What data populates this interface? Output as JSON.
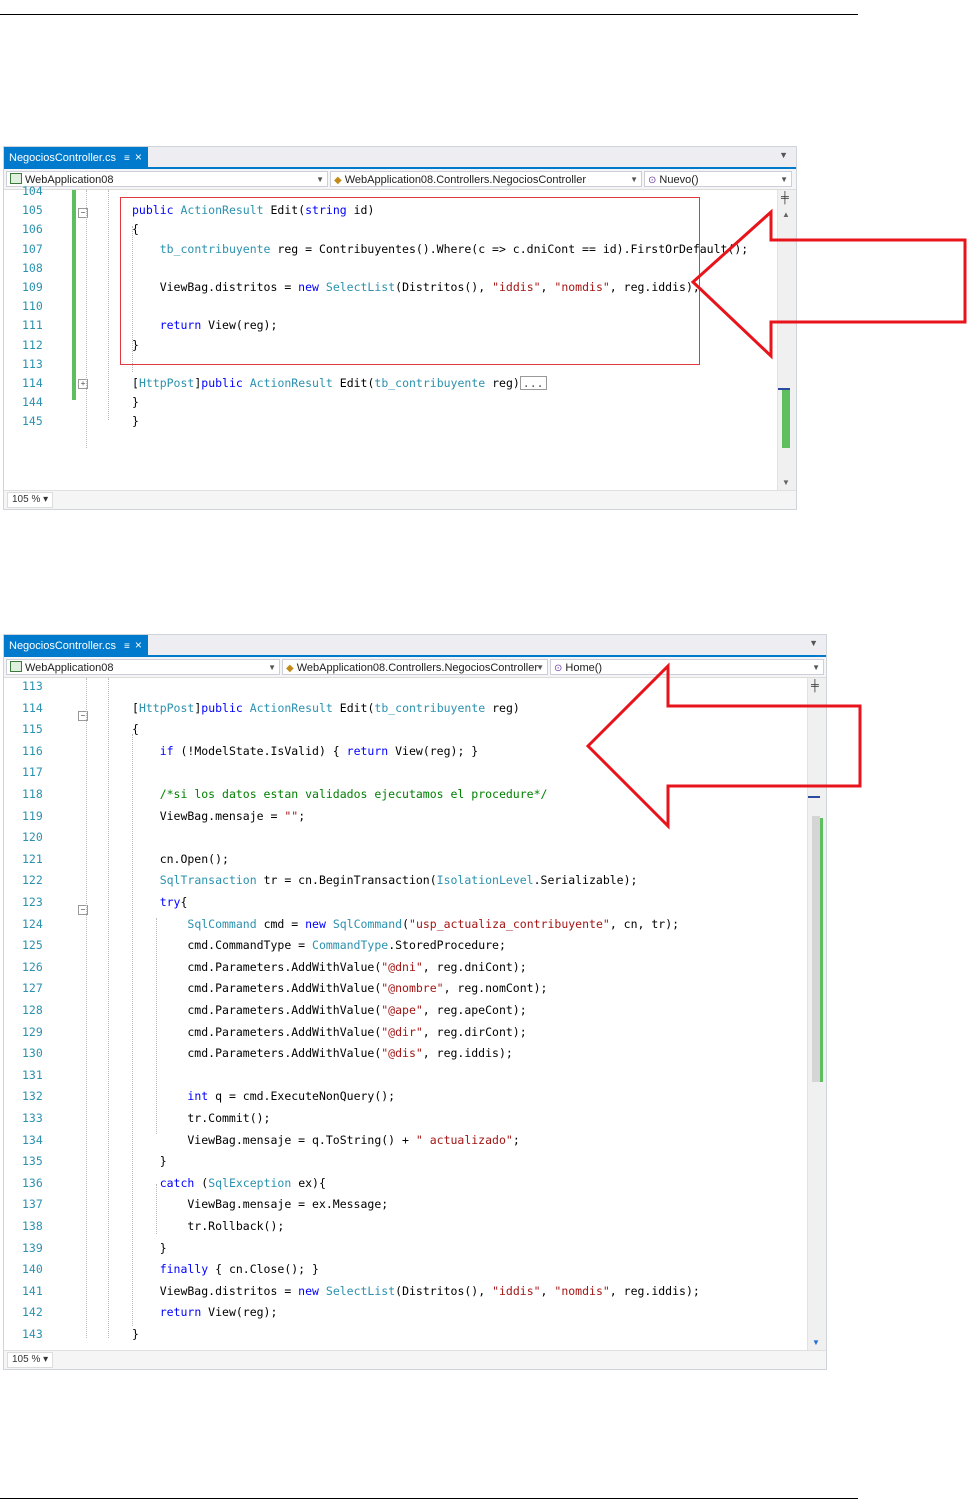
{
  "screenshot1": {
    "tab_label": "NegociosController.cs",
    "tab_pin": "≡",
    "tab_close": "×",
    "project_combo": "WebApplication08",
    "class_combo": "WebApplication08.Controllers.NegociosController",
    "member_combo": "Nuevo()",
    "zoom": "105 %",
    "lines": [
      {
        "n": "104",
        "code": ""
      },
      {
        "n": "105",
        "code": "<span class=\"kw\">public</span> <span class=\"ty\">ActionResult</span> Edit(<span class=\"kw\">string</span> id)"
      },
      {
        "n": "106",
        "code": "{"
      },
      {
        "n": "107",
        "code": "    <span class=\"ty\">tb_contribuyente</span> reg = Contribuyentes().Where(c => c.dniCont == id).FirstOrDefault();"
      },
      {
        "n": "108",
        "code": ""
      },
      {
        "n": "109",
        "code": "    ViewBag.distritos = <span class=\"kw\">new</span> <span class=\"ty\">SelectList</span>(Distritos(), <span class=\"st\">\"iddis\"</span>, <span class=\"st\">\"nomdis\"</span>, reg.iddis);"
      },
      {
        "n": "110",
        "code": ""
      },
      {
        "n": "111",
        "code": "    <span class=\"kw\">return</span> View(reg);"
      },
      {
        "n": "112",
        "code": "}"
      },
      {
        "n": "113",
        "code": ""
      },
      {
        "n": "114",
        "code": "[<span class=\"ty\">HttpPost</span>]<span class=\"kw\">public</span> <span class=\"ty\">ActionResult</span> Edit(<span class=\"ty\">tb_contribuyente</span> reg)<span class=\"collapsed-box\">...</span>"
      },
      {
        "n": "144",
        "code": "}"
      },
      {
        "n": "145",
        "code": "}"
      }
    ]
  },
  "screenshot2": {
    "tab_label": "NegociosController.cs",
    "tab_pin": "≡",
    "tab_close": "×",
    "project_combo": "WebApplication08",
    "class_combo": "WebApplication08.Controllers.NegociosController",
    "member_combo": "Home()",
    "zoom": "105 %",
    "lines": [
      {
        "n": "113",
        "code": ""
      },
      {
        "n": "114",
        "code": "[<span class=\"ty\">HttpPost</span>]<span class=\"kw\">public</span> <span class=\"ty\">ActionResult</span> Edit(<span class=\"ty\">tb_contribuyente</span> reg)"
      },
      {
        "n": "115",
        "code": "{"
      },
      {
        "n": "116",
        "code": "    <span class=\"kw\">if</span> (!ModelState.IsValid) { <span class=\"kw\">return</span> View(reg); }"
      },
      {
        "n": "117",
        "code": ""
      },
      {
        "n": "118",
        "code": "    <span class=\"cm\">/*si los datos estan validados ejecutamos el procedure*/</span>"
      },
      {
        "n": "119",
        "code": "    ViewBag.mensaje = <span class=\"st\">\"\"</span>;"
      },
      {
        "n": "120",
        "code": ""
      },
      {
        "n": "121",
        "code": "    cn.Open();"
      },
      {
        "n": "122",
        "code": "    <span class=\"ty\">SqlTransaction</span> tr = cn.BeginTransaction(<span class=\"ty\">IsolationLevel</span>.Serializable);"
      },
      {
        "n": "123",
        "code": "    <span class=\"kw\">try</span>{"
      },
      {
        "n": "124",
        "code": "        <span class=\"ty\">SqlCommand</span> cmd = <span class=\"kw\">new</span> <span class=\"ty\">SqlCommand</span>(<span class=\"st\">\"usp_actualiza_contribuyente\"</span>, cn, tr);"
      },
      {
        "n": "125",
        "code": "        cmd.CommandType = <span class=\"ty\">CommandType</span>.StoredProcedure;"
      },
      {
        "n": "126",
        "code": "        cmd.Parameters.AddWithValue(<span class=\"st\">\"@dni\"</span>, reg.dniCont);"
      },
      {
        "n": "127",
        "code": "        cmd.Parameters.AddWithValue(<span class=\"st\">\"@nombre\"</span>, reg.nomCont);"
      },
      {
        "n": "128",
        "code": "        cmd.Parameters.AddWithValue(<span class=\"st\">\"@ape\"</span>, reg.apeCont);"
      },
      {
        "n": "129",
        "code": "        cmd.Parameters.AddWithValue(<span class=\"st\">\"@dir\"</span>, reg.dirCont);"
      },
      {
        "n": "130",
        "code": "        cmd.Parameters.AddWithValue(<span class=\"st\">\"@dis\"</span>, reg.iddis);"
      },
      {
        "n": "131",
        "code": ""
      },
      {
        "n": "132",
        "code": "        <span class=\"kw\">int</span> q = cmd.ExecuteNonQuery();"
      },
      {
        "n": "133",
        "code": "        tr.Commit();"
      },
      {
        "n": "134",
        "code": "        ViewBag.mensaje = q.ToString() + <span class=\"st\">\" actualizado\"</span>;"
      },
      {
        "n": "135",
        "code": "    }"
      },
      {
        "n": "136",
        "code": "    <span class=\"kw\">catch</span> (<span class=\"ty\">SqlException</span> ex){"
      },
      {
        "n": "137",
        "code": "        ViewBag.mensaje = ex.Message;"
      },
      {
        "n": "138",
        "code": "        tr.Rollback();"
      },
      {
        "n": "139",
        "code": "    }"
      },
      {
        "n": "140",
        "code": "    <span class=\"kw\">finally</span> { cn.Close(); }"
      },
      {
        "n": "141",
        "code": "    ViewBag.distritos = <span class=\"kw\">new</span> <span class=\"ty\">SelectList</span>(Distritos(), <span class=\"st\">\"iddis\"</span>, <span class=\"st\">\"nomdis\"</span>, reg.iddis);"
      },
      {
        "n": "142",
        "code": "    <span class=\"kw\">return</span> View(reg);"
      },
      {
        "n": "143",
        "code": "}"
      }
    ]
  },
  "colors": {
    "accent": "#007acc",
    "keyword": "#0000ff",
    "type": "#2b91af",
    "string": "#a31515",
    "comment": "#008000",
    "callout": "#e8141c"
  }
}
